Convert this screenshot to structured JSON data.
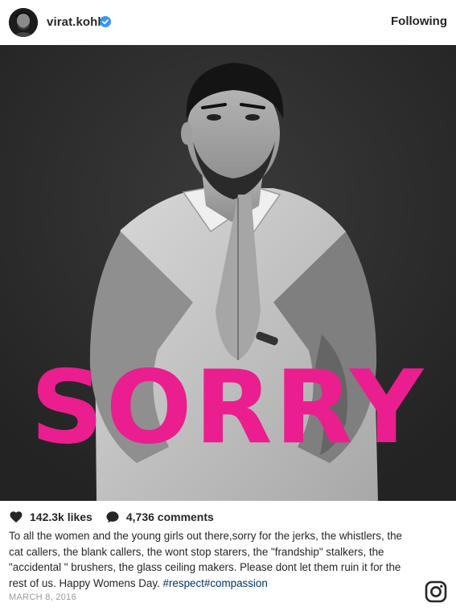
{
  "header": {
    "username": "virat.kohli",
    "follow_label": "Following"
  },
  "photo": {
    "overlay_text": "SORRY",
    "overlay_color": "#ea1e8f",
    "background_color": "#2e2e2e"
  },
  "stats": {
    "likes": "142.3k likes",
    "comments": "4,736 comments",
    "like_icon": "heart-icon",
    "comment_icon": "speech-bubble-icon"
  },
  "caption": {
    "text": "To all the women and the young girls out there,sorry for the jerks, the whistlers, the cat callers, the blank callers, the wont stop starers, the \"frandship\" stalkers, the \"accidental \" brushers, the glass ceiling makers. Please dont let them ruin it for the rest of us. Happy Womens Day.",
    "hashtags": "#respect#compassion"
  },
  "date": "MARCH 8, 2016",
  "brand_icon": "instagram-icon",
  "colors": {
    "verified_blue": "#3897f0",
    "hashtag": "#003569",
    "muted": "#999999"
  }
}
